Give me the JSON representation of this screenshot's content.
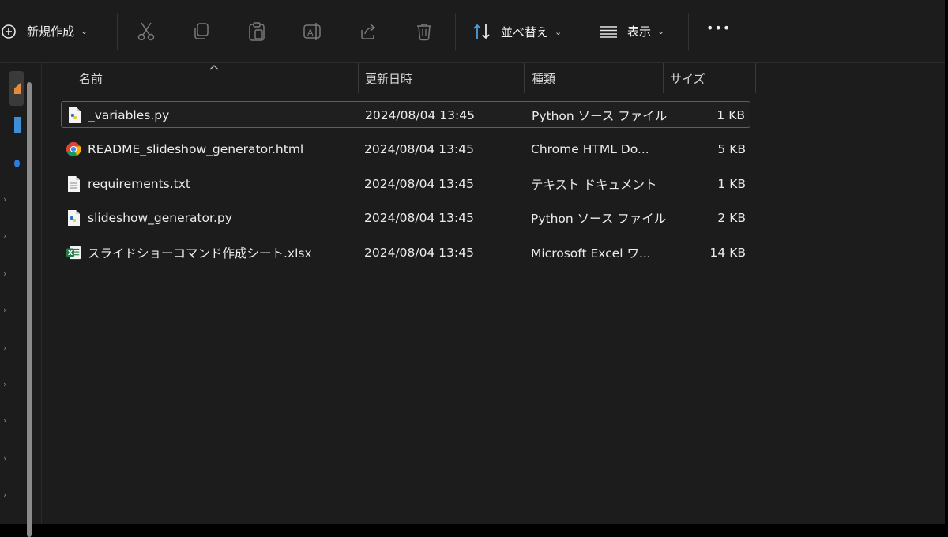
{
  "toolbar": {
    "new_label": "新規作成",
    "sort_label": "並べ替え",
    "view_label": "表示",
    "more_label": "•••"
  },
  "columns": {
    "name": "名前",
    "modified": "更新日時",
    "type": "種類",
    "size": "サイズ"
  },
  "files": [
    {
      "name": "_variables.py",
      "modified": "2024/08/04 13:45",
      "type": "Python ソース ファイル",
      "size": "1 KB",
      "icon": "python-file-icon"
    },
    {
      "name": "README_slideshow_generator.html",
      "modified": "2024/08/04 13:45",
      "type": "Chrome HTML Do...",
      "size": "5 KB",
      "icon": "chrome-icon"
    },
    {
      "name": "requirements.txt",
      "modified": "2024/08/04 13:45",
      "type": "テキスト ドキュメント",
      "size": "1 KB",
      "icon": "text-file-icon"
    },
    {
      "name": "slideshow_generator.py",
      "modified": "2024/08/04 13:45",
      "type": "Python ソース ファイル",
      "size": "2 KB",
      "icon": "python-file-icon"
    },
    {
      "name": "スライドショーコマンド作成シート.xlsx",
      "modified": "2024/08/04 13:45",
      "type": "Microsoft Excel ワ...",
      "size": "14 KB",
      "icon": "excel-icon"
    }
  ],
  "colors": {
    "background": "#1c1c1c",
    "accent": "#4ca0e0",
    "excel_green": "#1f7a44"
  }
}
